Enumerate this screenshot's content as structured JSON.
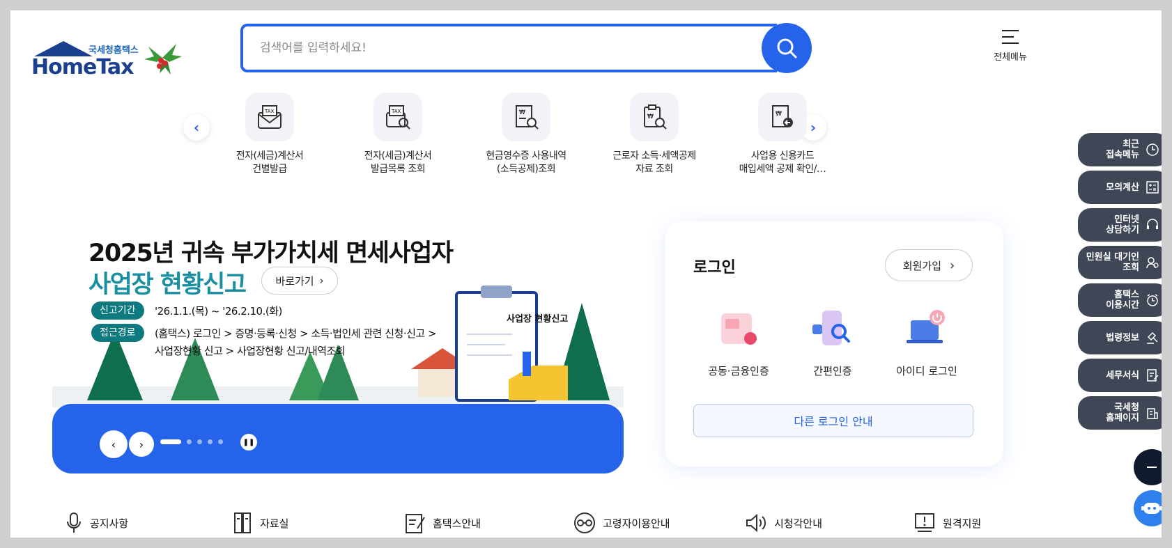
{
  "header": {
    "logo_sub": "국세청홈택스",
    "logo_main": "HomeTax",
    "search_placeholder": "검색어를 입력하세요!",
    "menu_label": "전체메뉴"
  },
  "quick_menu": [
    {
      "label1": "전자(세금)계산서",
      "label2": "건별발급"
    },
    {
      "label1": "전자(세금)계산서",
      "label2": "발급목록 조회"
    },
    {
      "label1": "현금영수증 사용내역",
      "label2": "(소득공제)조회"
    },
    {
      "label1": "근로자 소득·세액공제",
      "label2": "자료 조회"
    },
    {
      "label1": "사업용 신용카드",
      "label2": "매입세액 공제 확인/…"
    }
  ],
  "banner": {
    "title1": "2025년 귀속 부가가치세 면세사업자",
    "title2": "사업장 현황신고",
    "go_label": "바로가기",
    "tag_period": "신고기간",
    "period": "'26.1.1.(목) ~ '26.2.10.(화)",
    "tag_path": "접근경로",
    "path1": "(홈택스) 로그인 > 증명·등록·신청 > 소득·법인세 관련 신청·신고 >",
    "path2": "사업장현황 신고 > 사업장현황 신고/내역조회",
    "clipboard_text": "사업장 현황신고"
  },
  "login": {
    "title": "로그인",
    "join_label": "회원가입",
    "options": [
      "공동·금융인증",
      "간편인증",
      "아이디 로그인"
    ],
    "other_label": "다른 로그인 안내"
  },
  "bottom_links": [
    "공지사항",
    "자료실",
    "홈택스안내",
    "고령자이용안내",
    "시청각안내",
    "원격지원"
  ],
  "side_menu": [
    {
      "l1": "최근",
      "l2": "접속메뉴"
    },
    {
      "l1": "모의계산",
      "l2": ""
    },
    {
      "l1": "인터넷",
      "l2": "상담하기"
    },
    {
      "l1": "민원실 대기인",
      "l2": "조회"
    },
    {
      "l1": "홈택스",
      "l2": "이용시간"
    },
    {
      "l1": "법령정보",
      "l2": ""
    },
    {
      "l1": "세무서식",
      "l2": ""
    },
    {
      "l1": "국세청",
      "l2": "홈페이지"
    }
  ],
  "colors": {
    "primary": "#2563eb",
    "teal": "#0d7a80",
    "side_bg": "#3f4756"
  }
}
